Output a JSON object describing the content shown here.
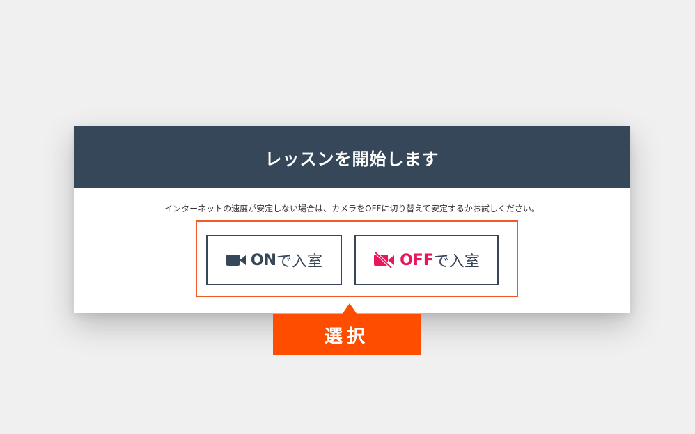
{
  "dialog": {
    "title": "レッスンを開始します",
    "message": "インターネットの速度が安定しない場合は、カメラをOFFに切り替えて安定するかお試しください。"
  },
  "buttons": {
    "camera_on": {
      "strong": "ON",
      "rest": "で入室",
      "icon": "video-camera-icon"
    },
    "camera_off": {
      "strong": "OFF",
      "rest": "で入室",
      "icon": "video-camera-off-icon"
    }
  },
  "callout": {
    "label": "選択"
  },
  "colors": {
    "header_bg": "#37475a",
    "accent_orange": "#ff4d00",
    "highlight_border": "#f05a28",
    "off_red": "#e8175d",
    "button_text": "#37475a",
    "page_bg": "#f0f0f0"
  }
}
